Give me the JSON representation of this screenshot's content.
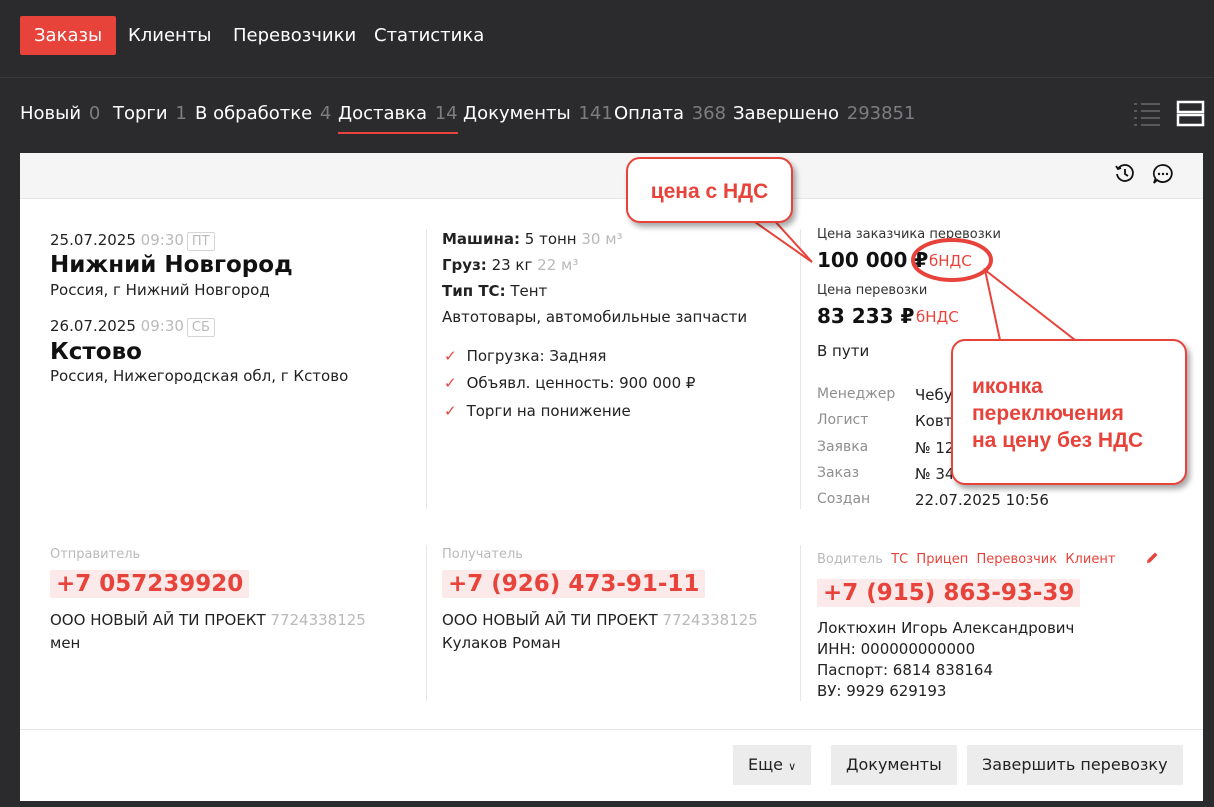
{
  "topnav": {
    "items": [
      {
        "label": "Заказы",
        "active": true
      },
      {
        "label": "Клиенты"
      },
      {
        "label": "Перевозчики"
      },
      {
        "label": "Статистика"
      }
    ]
  },
  "tabs": [
    {
      "label": "Новый",
      "count": "0"
    },
    {
      "label": "Торги",
      "count": "1"
    },
    {
      "label": "В обработке",
      "count": "4"
    },
    {
      "label": "Доставка",
      "count": "14",
      "active": true
    },
    {
      "label": "Документы",
      "count": "141"
    },
    {
      "label": "Оплата",
      "count": "368"
    },
    {
      "label": "Завершено",
      "count": "293851"
    }
  ],
  "route": {
    "from": {
      "date": "25.07.2025",
      "time": "09:30",
      "day": "ПТ",
      "city": "Нижний Новгород",
      "address": "Россия, г Нижний Новгород"
    },
    "to": {
      "date": "26.07.2025",
      "time": "09:30",
      "day": "СБ",
      "city": "Кстово",
      "address": "Россия, Нижегородская обл, г Кстово"
    }
  },
  "cargo": {
    "machine_label": "Машина:",
    "machine_value": "5 тонн",
    "machine_volume": "30 м³",
    "cargo_label": "Груз:",
    "cargo_value": "23 кг",
    "cargo_volume": "22 м³",
    "ts_label": "Тип ТС:",
    "ts_value": "Тент",
    "description": "Автотовары, автомобильные запчасти",
    "checks": [
      "Погрузка: Задняя",
      "Объявл. ценность: 900 000 ₽",
      "Торги на понижение"
    ]
  },
  "prices": {
    "customer_label": "Цена заказчика перевозки",
    "customer_price": "100 000 ₽",
    "customer_vat": "бНДС",
    "carrier_label": "Цена перевозки",
    "carrier_price": "83 233 ₽",
    "carrier_vat": "бНДС",
    "status": "В пути"
  },
  "details": [
    {
      "label": "Менеджер",
      "value": "Чебу"
    },
    {
      "label": "Логист",
      "value": "Ковт"
    },
    {
      "label": "Заявка",
      "value": "№ 12"
    },
    {
      "label": "Заказ",
      "value": "№ 34"
    },
    {
      "label": "Создан",
      "value": "22.07.2025 10:56"
    }
  ],
  "sender": {
    "label": "Отправитель",
    "phone": "+7 057239920",
    "company": "ООО НОВЫЙ АЙ ТИ ПРОЕКТ",
    "inn": "7724338125",
    "contact": "мен"
  },
  "receiver": {
    "label": "Получатель",
    "phone": "+7 (926) 473-91-11",
    "company": "ООО НОВЫЙ АЙ ТИ ПРОЕКТ",
    "inn": "7724338125",
    "contact": "Кулаков Роман"
  },
  "driver": {
    "label": "Водитель",
    "links": [
      "ТС",
      "Прицеп",
      "Перевозчик",
      "Клиент"
    ],
    "phone": "+7 (915) 863-93-39",
    "name": "Локтюхин Игорь Александрович",
    "inn": "ИНН: 000000000000",
    "passport": "Паспорт: 6814 838164",
    "license": "ВУ: 9929 629193"
  },
  "footer": {
    "more": "Еще",
    "documents": "Документы",
    "finish": "Завершить перевозку"
  },
  "callouts": {
    "vat_price": "цена с НДС",
    "toggle_line1": "иконка",
    "toggle_line2": "переключения",
    "toggle_line3": "на цену без НДС"
  },
  "colors": {
    "accent": "#e8433b",
    "dark_bg": "#2b2b2d"
  }
}
